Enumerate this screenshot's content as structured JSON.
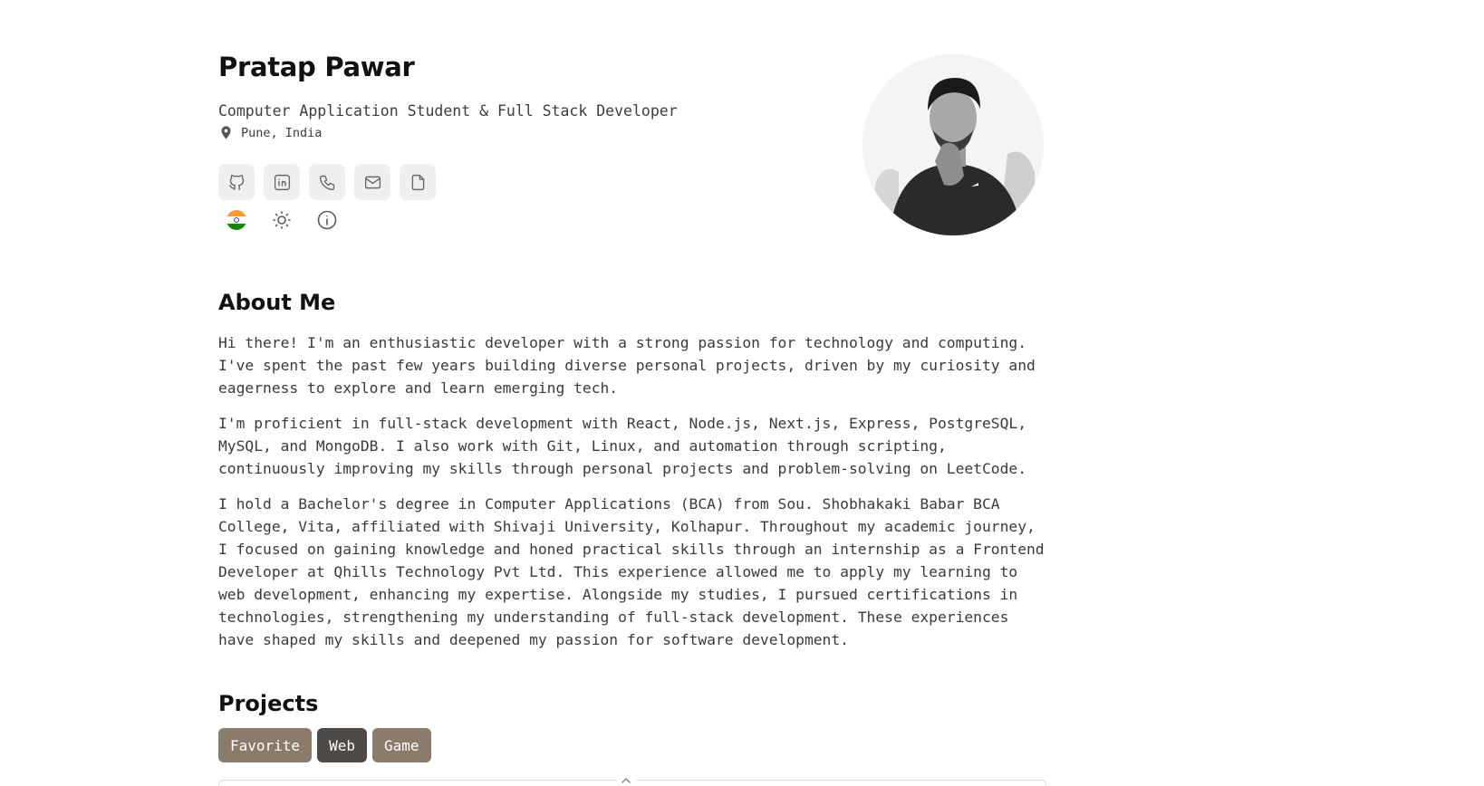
{
  "profile": {
    "name": "Pratap Pawar",
    "subtitle": "Computer Application Student & Full Stack Developer",
    "location": "Pune, India"
  },
  "social": [
    {
      "icon": "github-icon"
    },
    {
      "icon": "linkedin-icon"
    },
    {
      "icon": "phone-icon"
    },
    {
      "icon": "mail-icon"
    },
    {
      "icon": "document-icon"
    }
  ],
  "utilities": [
    {
      "icon": "india-flag-icon"
    },
    {
      "icon": "sun-icon"
    },
    {
      "icon": "info-icon"
    }
  ],
  "about": {
    "title": "About Me",
    "paragraphs": [
      "Hi there! I'm an enthusiastic developer with a strong passion for technology and computing. I've spent the past few years building diverse personal projects, driven by my curiosity and eagerness to explore and learn emerging tech.",
      "I'm proficient in full-stack development with React, Node.js, Next.js, Express, PostgreSQL, MySQL, and MongoDB. I also work with Git, Linux, and automation through scripting, continuously improving my skills through personal projects and problem-solving on LeetCode.",
      "I hold a Bachelor's degree in Computer Applications (BCA) from Sou. Shobhakaki Babar BCA College, Vita, affiliated with Shivaji University, Kolhapur. Throughout my academic journey, I focused on gaining knowledge and honed practical skills through an internship as a Frontend Developer at Qhills Technology Pvt Ltd. This experience allowed me to apply my learning to web development, enhancing my expertise. Alongside my studies, I pursued certifications in technologies, strengthening my understanding of full-stack development. These experiences have shaped my skills and deepened my passion for software development."
    ]
  },
  "projects": {
    "title": "Projects",
    "tags": [
      {
        "label": "Favorite",
        "color": "#8b7b6b"
      },
      {
        "label": "Web",
        "color": "#4e4a47"
      },
      {
        "label": "Game",
        "color": "#8b7b6b"
      }
    ]
  },
  "colors": {
    "icon_button_bg": "#efefef",
    "tag_muted": "#8b7b6b",
    "tag_active": "#4e4a47"
  }
}
